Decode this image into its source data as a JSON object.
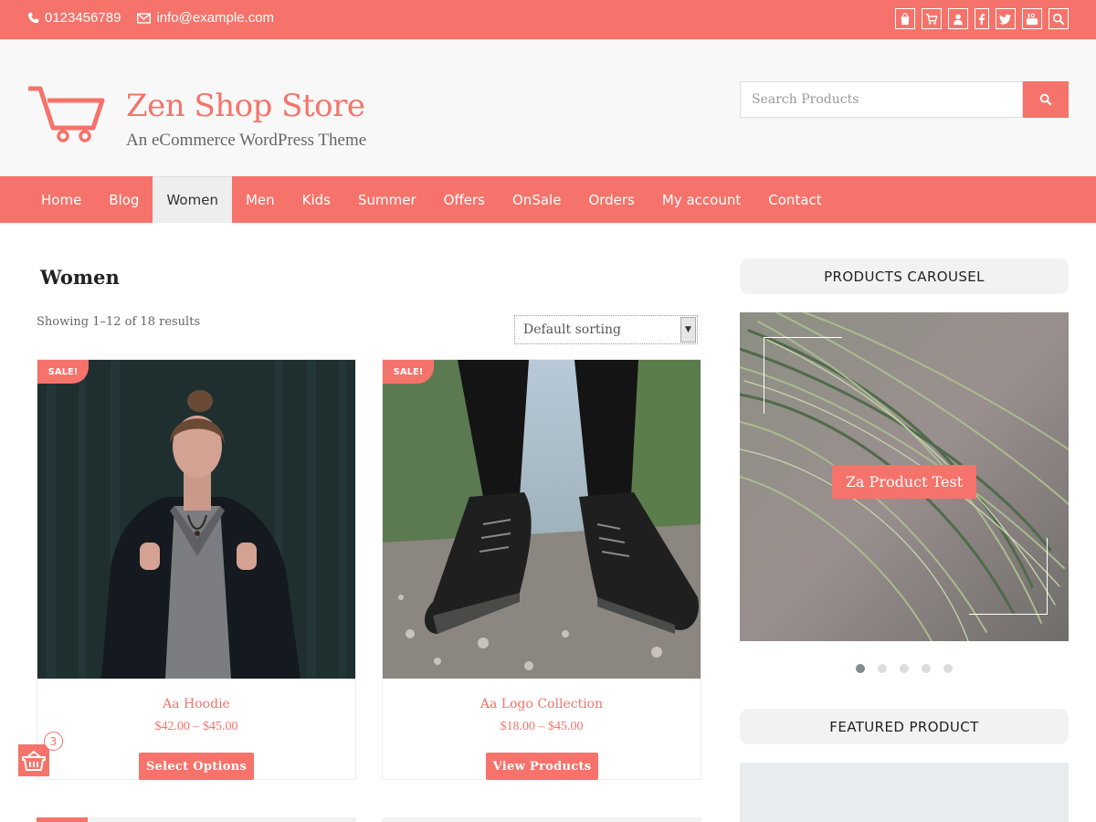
{
  "topbar": {
    "phone": "0123456789",
    "email": "info@example.com",
    "socials": [
      "shopping-bag-icon",
      "cart-icon",
      "user-icon",
      "facebook-icon",
      "twitter-icon",
      "youtube-icon",
      "search-icon"
    ]
  },
  "header": {
    "brand": "Zen Shop Store",
    "tagline": "An eCommerce WordPress Theme",
    "search_placeholder": "Search Products"
  },
  "nav": {
    "items": [
      "Home",
      "Blog",
      "Women",
      "Men",
      "Kids",
      "Summer",
      "Offers",
      "OnSale",
      "Orders",
      "My account",
      "Contact"
    ],
    "active": "Women"
  },
  "main": {
    "title": "Women",
    "result_count": "Showing 1–12 of 18 results",
    "sort_selected": "Default sorting",
    "products": [
      {
        "sale": "SALE!",
        "name": "Aa Hoodie",
        "price": "$42.00 – $45.00",
        "cta": "Select Options"
      },
      {
        "sale": "SALE!",
        "name": "Aa Logo Collection",
        "price": "$18.00 – $45.00",
        "cta": "View Products"
      }
    ]
  },
  "sidebar": {
    "carousel_title": "PRODUCTS CAROUSEL",
    "carousel_label": "Za Product Test",
    "carousel_slides": 5,
    "carousel_active_slide": 1,
    "featured_title": "FEATURED PRODUCT"
  },
  "floating_cart": {
    "count": "3"
  },
  "colors": {
    "accent": "#f5736a",
    "header_bg": "#f8f8f8",
    "active_nav_bg": "#eeeeee"
  }
}
